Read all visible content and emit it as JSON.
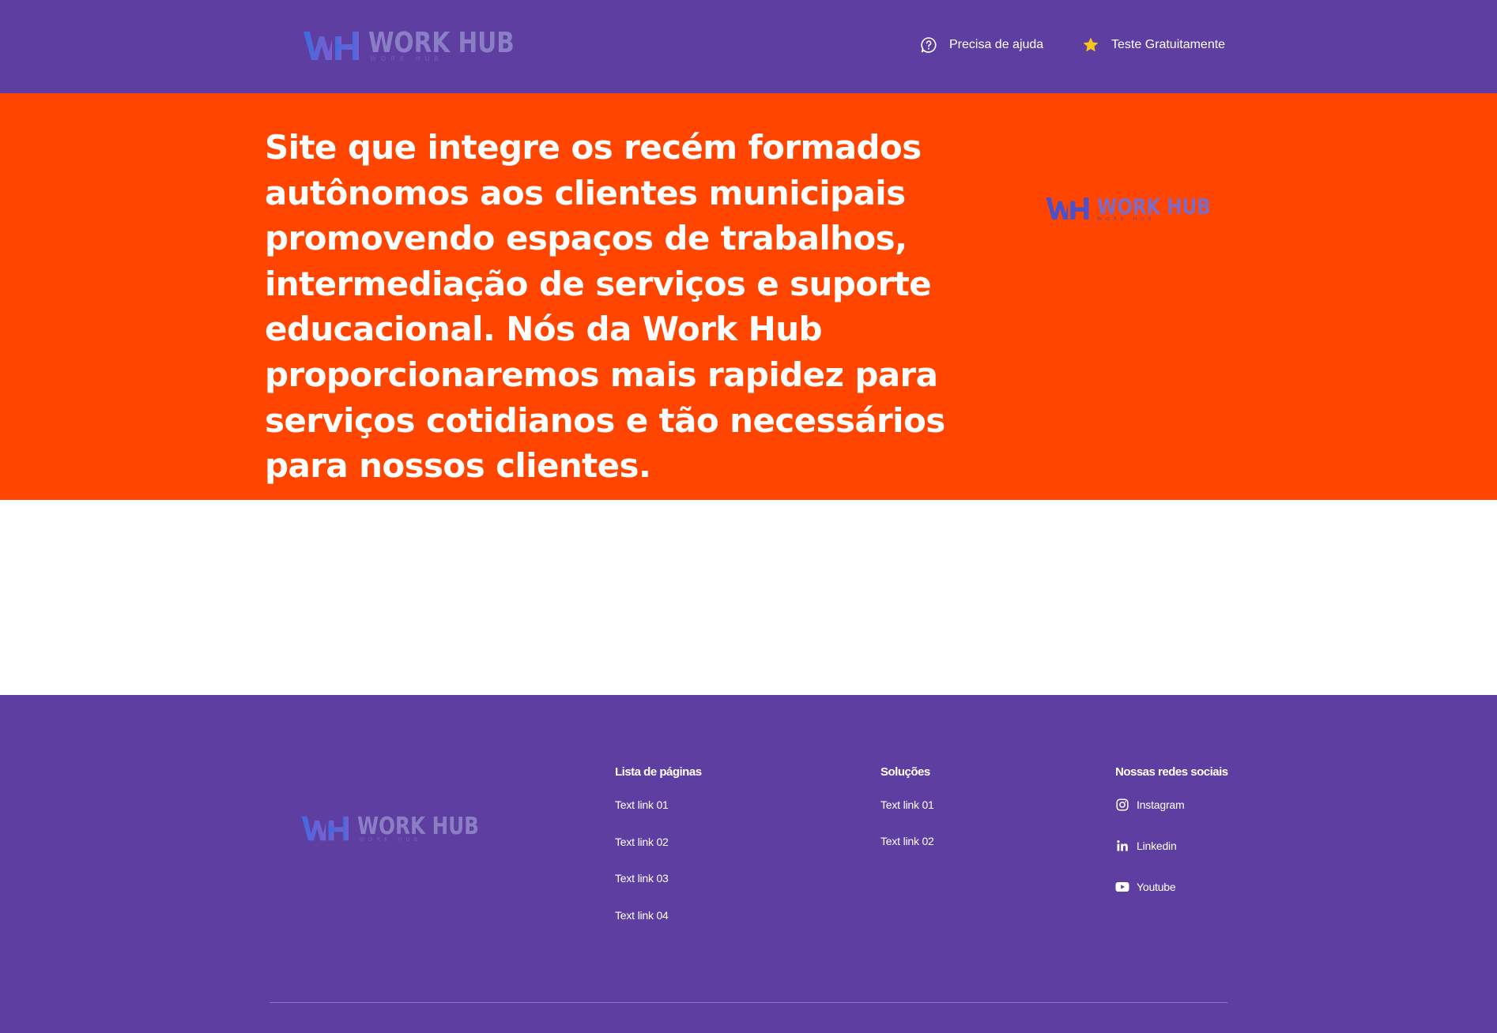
{
  "brand": {
    "name": "WORK HUB",
    "tagline": "WORK HUB"
  },
  "header": {
    "help_label": "Precisa de ajuda",
    "help_icon": "question-bubble-icon",
    "trial_label": "Teste Gratuitamente",
    "trial_icon": "star-icon"
  },
  "hero": {
    "text": "Site que integre os recém formados autônomos aos clientes municipais promovendo espaços de trabalhos, intermediação de serviços e suporte educacional. Nós da Work Hub proporcionaremos mais rapidez para serviços cotidianos e tão necessários para nossos clientes."
  },
  "footer": {
    "pages": {
      "title": "Lista de páginas",
      "links": [
        "Text link 01",
        "Text link 02",
        "Text link 03",
        "Text link 04"
      ]
    },
    "solutions": {
      "title": "Soluções",
      "links": [
        "Text link 01",
        "Text link 02"
      ]
    },
    "social": {
      "title": "Nossas redes sociais",
      "links": [
        {
          "label": "Instagram",
          "icon": "instagram-icon"
        },
        {
          "label": "Linkedin",
          "icon": "linkedin-icon"
        },
        {
          "label": "Youtube",
          "icon": "youtube-icon"
        }
      ]
    }
  },
  "colors": {
    "purple": "#5f3ea2",
    "orange": "#ff4500",
    "white": "#ffffff",
    "star": "#f7c518",
    "logo_blue": "#4a5fd8",
    "logo_text": "#8a7fc4"
  }
}
